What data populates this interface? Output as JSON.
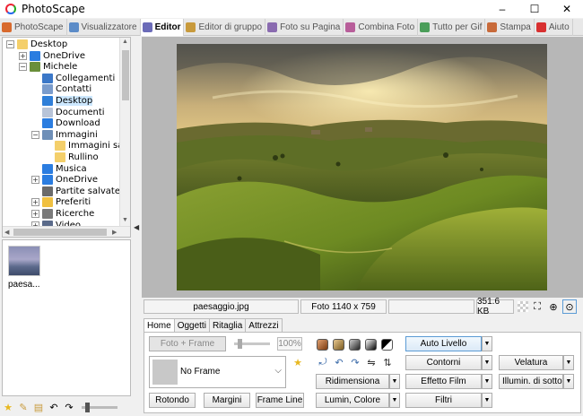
{
  "window": {
    "title": "PhotoScape",
    "minimize": "–",
    "maximize": "☐",
    "close": "✕"
  },
  "tabs": [
    {
      "label": "PhotoScape",
      "color": "#d86a2e",
      "active": false
    },
    {
      "label": "Visualizzatore",
      "color": "#5c8cc8",
      "active": false
    },
    {
      "label": "Editor",
      "color": "#6b6bb8",
      "active": true
    },
    {
      "label": "Editor di gruppo",
      "color": "#c89a3c",
      "active": false
    },
    {
      "label": "Foto su Pagina",
      "color": "#8a6bb0",
      "active": false
    },
    {
      "label": "Combina Foto",
      "color": "#b85e9a",
      "active": false
    },
    {
      "label": "Tutto per Gif",
      "color": "#4b9e5a",
      "active": false
    },
    {
      "label": "Stampa",
      "color": "#c86a3a",
      "active": false
    },
    {
      "label": "Aiuto",
      "color": "#d83030",
      "active": false
    }
  ],
  "tree": [
    {
      "label": "Desktop",
      "level": 0,
      "expander": "⊟",
      "icon": "folder-icon",
      "color": "#f4cf6a"
    },
    {
      "label": "OneDrive",
      "level": 1,
      "expander": "⊞",
      "icon": "cloud-icon",
      "color": "#2b7de0"
    },
    {
      "label": "Michele",
      "level": 1,
      "expander": "⊟",
      "icon": "user-icon",
      "color": "#6a8f3a"
    },
    {
      "label": "Collegamenti",
      "level": 2,
      "expander": "",
      "icon": "link-icon",
      "color": "#3b78c8"
    },
    {
      "label": "Contatti",
      "level": 2,
      "expander": "",
      "icon": "contacts-icon",
      "color": "#7a9ccc"
    },
    {
      "label": "Desktop",
      "level": 2,
      "expander": "",
      "icon": "desktop-icon",
      "color": "#2f7fd8",
      "selected": true
    },
    {
      "label": "Documenti",
      "level": 2,
      "expander": "",
      "icon": "document-icon",
      "color": "#b8c4d8"
    },
    {
      "label": "Download",
      "level": 2,
      "expander": "",
      "icon": "download-icon",
      "color": "#2b7de0"
    },
    {
      "label": "Immagini",
      "level": 2,
      "expander": "⊟",
      "icon": "images-icon",
      "color": "#6e8fb8"
    },
    {
      "label": "Immagini salvate",
      "level": 3,
      "expander": "",
      "icon": "folder-icon",
      "color": "#f4cf6a"
    },
    {
      "label": "Rullino",
      "level": 3,
      "expander": "",
      "icon": "folder-icon",
      "color": "#f4cf6a"
    },
    {
      "label": "Musica",
      "level": 2,
      "expander": "",
      "icon": "music-icon",
      "color": "#2b7de0"
    },
    {
      "label": "OneDrive",
      "level": 2,
      "expander": "⊞",
      "icon": "cloud-icon",
      "color": "#2b7de0"
    },
    {
      "label": "Partite salvate",
      "level": 2,
      "expander": "",
      "icon": "game-icon",
      "color": "#6a6a6a"
    },
    {
      "label": "Preferiti",
      "level": 2,
      "expander": "⊞",
      "icon": "star-icon",
      "color": "#f0c040"
    },
    {
      "label": "Ricerche",
      "level": 2,
      "expander": "⊞",
      "icon": "search-icon",
      "color": "#7a7a7a"
    },
    {
      "label": "Video",
      "level": 2,
      "expander": "⊞",
      "icon": "video-icon",
      "color": "#5a6a8a"
    }
  ],
  "thumbnail": {
    "name": "paesa..."
  },
  "status": {
    "filename": "paesaggio.jpg",
    "dimensions": "Foto 1140 x 759",
    "extra": "",
    "filesize": "351.6 KB"
  },
  "editor_tabs": [
    "Home",
    "Oggetti",
    "Ritaglia",
    "Attrezzi"
  ],
  "editor": {
    "frame_button": "Foto + Frame",
    "frame_percent": "100%",
    "frame_name": "No Frame",
    "rotondo": "Rotondo",
    "margini": "Margini",
    "frame_line": "Frame Line",
    "auto_livello": "Auto Livello",
    "contorni": "Contorni",
    "velatura": "Velatura",
    "ridimensiona": "Ridimensiona",
    "effetto_film": "Effetto Film",
    "illumin": "Illumin. di sottofondo",
    "lumin_colore": "Lumin, Colore",
    "filtri": "Filtri",
    "dd_arrow": "▼",
    "star_icon": "★"
  }
}
